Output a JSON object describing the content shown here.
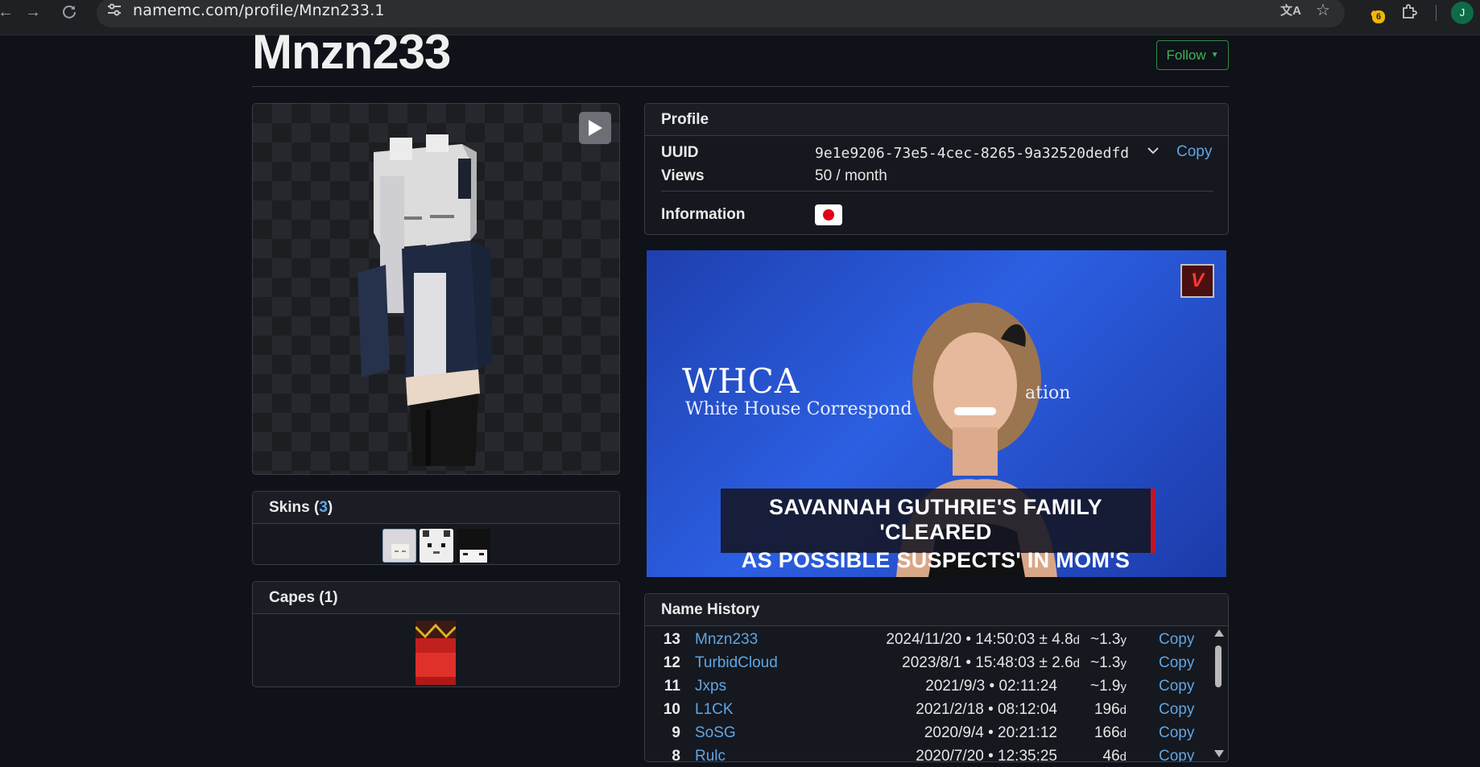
{
  "browser": {
    "url": "namemc.com/profile/Mnzn233.1",
    "extension_badge": "6",
    "profile_initial": "J"
  },
  "page": {
    "title": "Mnzn233",
    "follow_label": "Follow"
  },
  "skins": {
    "label": "Skins",
    "count": "3"
  },
  "capes": {
    "label": "Capes (1)"
  },
  "profile": {
    "header": "Profile",
    "uuid_label": "UUID",
    "uuid_value": "9e1e9206-73e5-4cec-8265-9a32520dedfd",
    "copy_label": "Copy",
    "views_label": "Views",
    "views_value": "50 / month",
    "information_label": "Information"
  },
  "ad": {
    "whca": "WHCA",
    "whca_sub": "White House Correspond",
    "whca_sub_tail": "ation",
    "caption_line1": "SAVANNAH GUTHRIE'S FAMILY 'CLEARED",
    "caption_line2": "AS POSSIBLE SUSPECTS' IN MOM'S DISAPPEARANCE"
  },
  "name_history": {
    "header": "Name History",
    "rows": [
      {
        "num": "13",
        "name": "Mnzn233",
        "date": "2024/11/20 • 14:50:03 ± 4.8",
        "date_unit": "d",
        "dur": "~1.3",
        "dur_unit": "y",
        "copy": "Copy"
      },
      {
        "num": "12",
        "name": "TurbidCloud",
        "date": "2023/8/1 • 15:48:03 ± 2.6",
        "date_unit": "d",
        "dur": "~1.3",
        "dur_unit": "y",
        "copy": "Copy"
      },
      {
        "num": "11",
        "name": "Jxps",
        "date": "2021/9/3 • 02:11:24",
        "date_unit": "",
        "dur": "~1.9",
        "dur_unit": "y",
        "copy": "Copy"
      },
      {
        "num": "10",
        "name": "L1CK",
        "date": "2021/2/18 • 08:12:04",
        "date_unit": "",
        "dur": "196",
        "dur_unit": "d",
        "copy": "Copy"
      },
      {
        "num": "9",
        "name": "SoSG",
        "date": "2020/9/4 • 20:21:12",
        "date_unit": "",
        "dur": "166",
        "dur_unit": "d",
        "copy": "Copy"
      },
      {
        "num": "8",
        "name": "Rulc",
        "date": "2020/7/20 • 12:35:25",
        "date_unit": "",
        "dur": "46",
        "dur_unit": "d",
        "copy": "Copy"
      }
    ]
  },
  "colors": {
    "accent_link": "#5fa6e6",
    "follow_green": "#3ab45a",
    "page_bg": "#0f1218"
  },
  "icons": [
    "back-arrow-icon",
    "forward-arrow-icon",
    "reload-icon",
    "site-settings-icon",
    "translate-icon",
    "star-icon",
    "extension-icon",
    "puzzle-icon",
    "play-icon",
    "chevron-down-icon",
    "japan-flag-icon"
  ]
}
